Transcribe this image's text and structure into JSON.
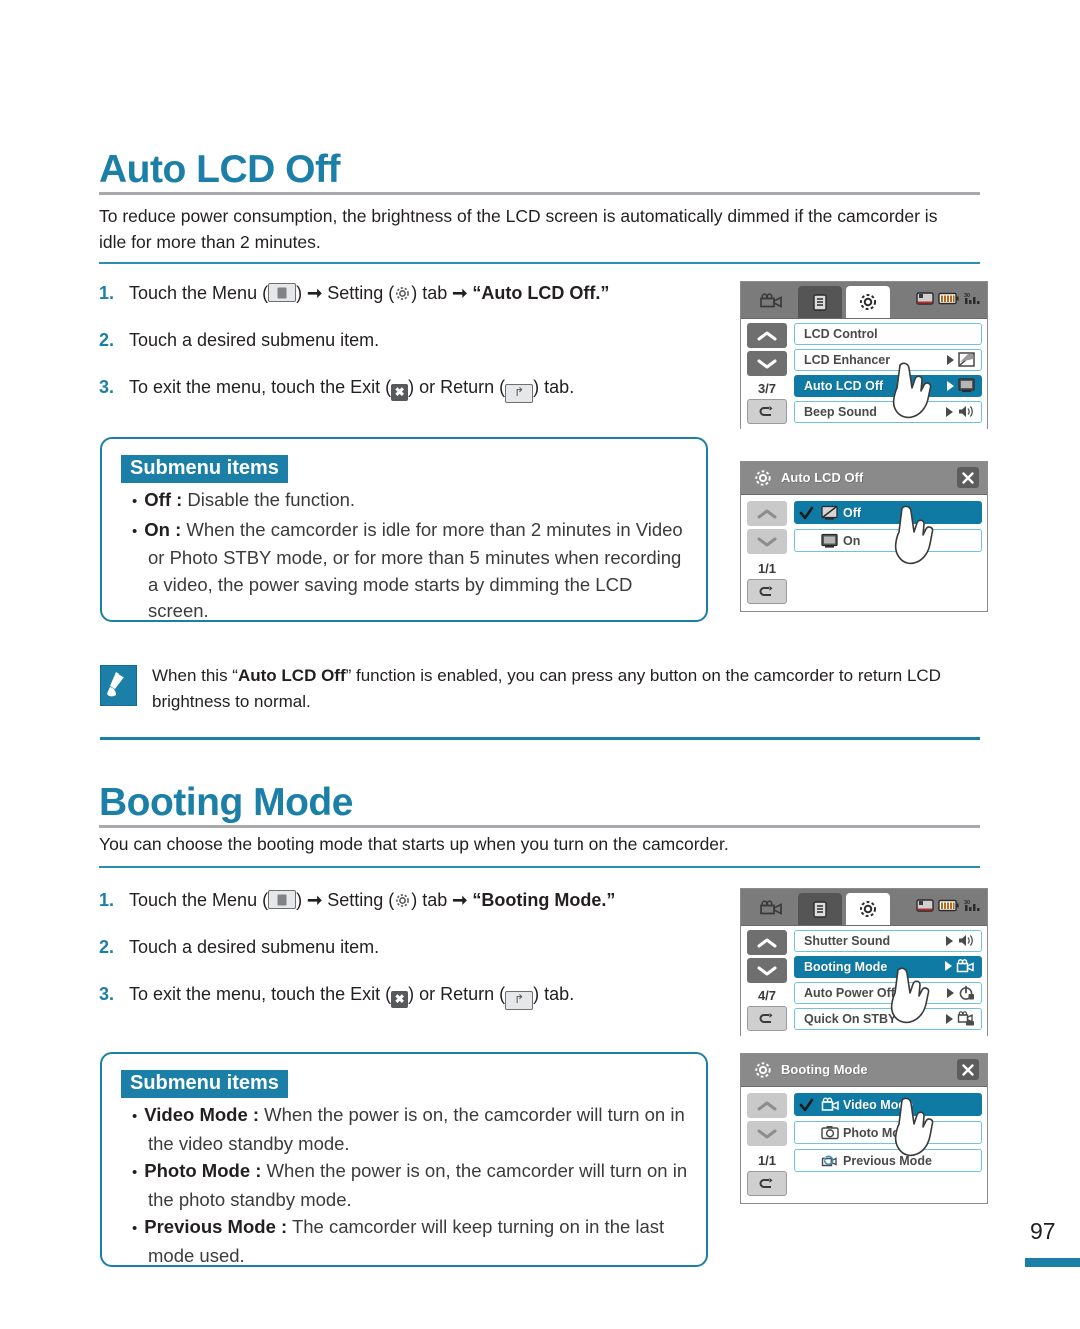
{
  "page": {
    "number": "97"
  },
  "sections": [
    {
      "id": "auto-lcd-off",
      "title": "Auto LCD Off",
      "intro": "To reduce power consumption, the brightness of the LCD screen is automatically dimmed if the camcorder is idle for more than 2 minutes.",
      "steps": [
        {
          "num": "1.",
          "pre": "Touch the Menu (",
          "mid": ") ",
          "setting": "Setting (",
          "post": ") tab ",
          "target": "“Auto LCD Off.”"
        },
        {
          "num": "2.",
          "text": "Touch a desired submenu item."
        },
        {
          "num": "3.",
          "pre": "To exit the menu, touch the Exit (",
          "mid": ") or Return (",
          "post": ") tab."
        }
      ],
      "submenu": {
        "badge": "Submenu items",
        "items": [
          {
            "term": "Off :",
            "desc": " Disable the function."
          },
          {
            "term": "On :",
            "desc": " When the camcorder is idle for more than 2 minutes in Video or Photo STBY mode, or for more than 5 minutes when recording a video, the power saving mode starts by dimming the LCD screen."
          }
        ]
      }
    },
    {
      "id": "booting-mode",
      "title": "Booting Mode",
      "intro": "You can choose the booting mode that starts up when you turn on the camcorder.",
      "steps": [
        {
          "num": "1.",
          "pre": "Touch the Menu (",
          "mid": ") ",
          "setting": "Setting (",
          "post": ") tab ",
          "target": "“Booting Mode.”"
        },
        {
          "num": "2.",
          "text": "Touch a desired submenu item."
        },
        {
          "num": "3.",
          "pre": "To exit the menu, touch the Exit (",
          "mid": ") or Return (",
          "post": ") tab."
        }
      ],
      "submenu": {
        "badge": "Submenu items",
        "items": [
          {
            "term": "Video Mode :",
            "desc": " When the power is on, the camcorder will turn on in the video standby mode."
          },
          {
            "term": "Photo Mode :",
            "desc": " When the power is on, the camcorder will turn on in the photo standby mode."
          },
          {
            "term": "Previous Mode :",
            "desc": " The camcorder will keep turning on in the last mode used."
          }
        ]
      }
    }
  ],
  "note": {
    "pre": "When this “",
    "bold": "Auto LCD Off",
    "post": "” function is enabled, you can press any button on the camcorder to return LCD brightness to normal."
  },
  "screens": {
    "menu_lcd": {
      "tabs": [
        "camcorder-tab",
        "playback-tab",
        "setting-tab"
      ],
      "pager": "3/7",
      "rows": [
        {
          "label": "LCD Control",
          "selected": false,
          "arrow": false,
          "icon": ""
        },
        {
          "label": "LCD Enhancer",
          "selected": false,
          "arrow": true,
          "icon": "enhancer-icon"
        },
        {
          "label": "Auto LCD Off",
          "selected": true,
          "arrow": true,
          "icon": "lcd-off-icon"
        },
        {
          "label": "Beep Sound",
          "selected": false,
          "arrow": true,
          "icon": "speaker-icon"
        }
      ]
    },
    "auto_lcd_off_options": {
      "title": "Auto LCD Off",
      "pager": "1/1",
      "options": [
        {
          "label": "Off",
          "selected": true,
          "checked": true,
          "icon": "lcd-off-disabled-icon"
        },
        {
          "label": "On",
          "selected": false,
          "checked": false,
          "icon": "lcd-screen-icon"
        }
      ]
    },
    "menu_lcd_booting": {
      "pager": "4/7",
      "rows": [
        {
          "label": "Shutter Sound",
          "selected": false,
          "arrow": true,
          "icon": "speaker-icon"
        },
        {
          "label": "Booting Mode",
          "selected": true,
          "arrow": true,
          "icon": "camcorder-icon"
        },
        {
          "label": "Auto Power Off",
          "selected": false,
          "arrow": true,
          "icon": "power-off-icon"
        },
        {
          "label": "Quick On STBY",
          "selected": false,
          "arrow": true,
          "icon": "quick-on-icon"
        }
      ]
    },
    "booting_mode_options": {
      "title": "Booting Mode",
      "pager": "1/1",
      "options": [
        {
          "label": "Video Mode",
          "selected": true,
          "checked": true,
          "icon": "camcorder-icon"
        },
        {
          "label": "Photo Mode",
          "selected": false,
          "checked": false,
          "icon": "camera-icon"
        },
        {
          "label": "Previous Mode",
          "selected": false,
          "checked": false,
          "icon": "previous-mode-icon"
        }
      ]
    }
  },
  "colors": {
    "accent": "#1b7fa8",
    "selected_row": "#0f7ba5",
    "row_border": "#6fc2e0"
  }
}
